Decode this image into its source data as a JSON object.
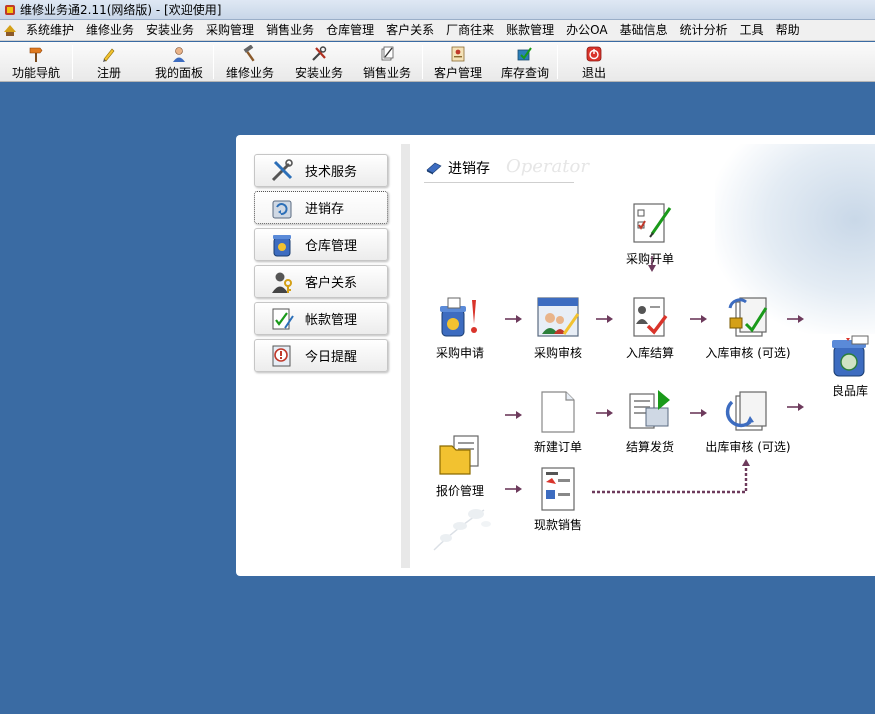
{
  "window": {
    "title": "维修业务通2.11(网络版) - [欢迎使用]"
  },
  "menu": [
    "系统维护",
    "维修业务",
    "安装业务",
    "采购管理",
    "销售业务",
    "仓库管理",
    "客户关系",
    "厂商往来",
    "账款管理",
    "办公OA",
    "基础信息",
    "统计分析",
    "工具",
    "帮助"
  ],
  "toolbar": {
    "nav": "功能导航",
    "register": "注册",
    "dashboard": "我的面板",
    "repair": "维修业务",
    "install": "安装业务",
    "sales": "销售业务",
    "customer": "客户管理",
    "stock": "库存查询",
    "exit": "退出"
  },
  "sidebar": {
    "items": [
      "技术服务",
      "进销存",
      "仓库管理",
      "客户关系",
      "帐款管理",
      "今日提醒"
    ],
    "active_index": 1
  },
  "content": {
    "section_title": "进销存",
    "watermark": "Operator",
    "nodes": {
      "purchase_order": "采购开单",
      "purchase_request": "采购申请",
      "purchase_review": "采购审核",
      "inbound_settle": "入库结算",
      "inbound_review": "入库审核 (可选)",
      "good_stock": "良品库",
      "new_order": "新建订单",
      "settle_ship": "结算发货",
      "outbound_review": "出库审核 (可选)",
      "quote": "报价管理",
      "cash_sale": "现款销售"
    }
  },
  "colors": {
    "desktop": "#3a6ba3",
    "arrow": "#6d3a5c"
  }
}
